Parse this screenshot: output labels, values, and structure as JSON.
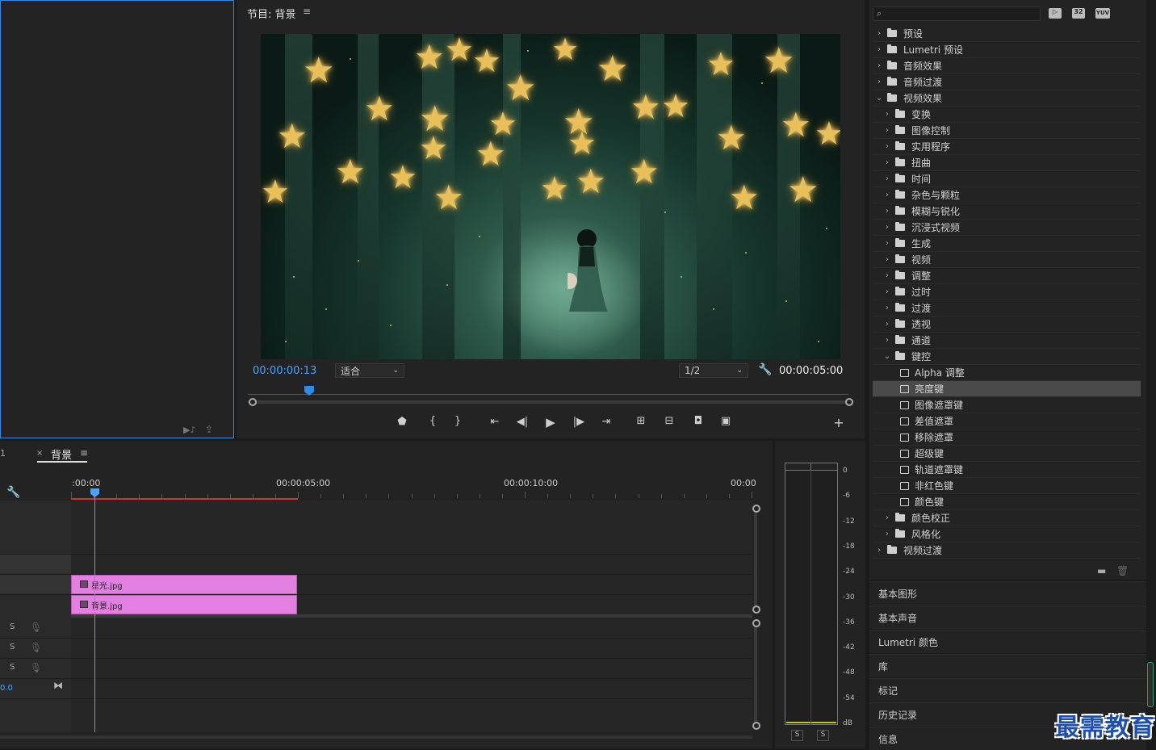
{
  "program": {
    "title": "节目: 背景",
    "menu_icon": "hamburger-icon",
    "timecode": "00:00:00:13",
    "fit_value": "适合",
    "resolution_value": "1/2",
    "duration": "00:00:05:00"
  },
  "effects": {
    "search_placeholder": "",
    "badges": [
      "32",
      "YUV"
    ],
    "items": [
      {
        "label": "预设",
        "level": 0,
        "expanded": false,
        "type": "folder"
      },
      {
        "label": "Lumetri 预设",
        "level": 0,
        "expanded": false,
        "type": "folder"
      },
      {
        "label": "音频效果",
        "level": 0,
        "expanded": false,
        "type": "folder"
      },
      {
        "label": "音频过渡",
        "level": 0,
        "expanded": false,
        "type": "folder"
      },
      {
        "label": "视频效果",
        "level": 0,
        "expanded": true,
        "type": "folder"
      },
      {
        "label": "变换",
        "level": 1,
        "expanded": false,
        "type": "folder"
      },
      {
        "label": "图像控制",
        "level": 1,
        "expanded": false,
        "type": "folder"
      },
      {
        "label": "实用程序",
        "level": 1,
        "expanded": false,
        "type": "folder"
      },
      {
        "label": "扭曲",
        "level": 1,
        "expanded": false,
        "type": "folder"
      },
      {
        "label": "时间",
        "level": 1,
        "expanded": false,
        "type": "folder"
      },
      {
        "label": "杂色与颗粒",
        "level": 1,
        "expanded": false,
        "type": "folder"
      },
      {
        "label": "模糊与锐化",
        "level": 1,
        "expanded": false,
        "type": "folder"
      },
      {
        "label": "沉浸式视频",
        "level": 1,
        "expanded": false,
        "type": "folder"
      },
      {
        "label": "生成",
        "level": 1,
        "expanded": false,
        "type": "folder"
      },
      {
        "label": "视频",
        "level": 1,
        "expanded": false,
        "type": "folder"
      },
      {
        "label": "调整",
        "level": 1,
        "expanded": false,
        "type": "folder"
      },
      {
        "label": "过时",
        "level": 1,
        "expanded": false,
        "type": "folder"
      },
      {
        "label": "过渡",
        "level": 1,
        "expanded": false,
        "type": "folder"
      },
      {
        "label": "透视",
        "level": 1,
        "expanded": false,
        "type": "folder"
      },
      {
        "label": "通道",
        "level": 1,
        "expanded": false,
        "type": "folder"
      },
      {
        "label": "键控",
        "level": 1,
        "expanded": true,
        "type": "folder"
      },
      {
        "label": "Alpha 调整",
        "level": 2,
        "type": "effect"
      },
      {
        "label": "亮度键",
        "level": 2,
        "type": "effect",
        "selected": true
      },
      {
        "label": "图像遮罩键",
        "level": 2,
        "type": "effect"
      },
      {
        "label": "差值遮罩",
        "level": 2,
        "type": "effect"
      },
      {
        "label": "移除遮罩",
        "level": 2,
        "type": "effect"
      },
      {
        "label": "超级键",
        "level": 2,
        "type": "effect"
      },
      {
        "label": "轨道遮罩键",
        "level": 2,
        "type": "effect"
      },
      {
        "label": "非红色键",
        "level": 2,
        "type": "effect"
      },
      {
        "label": "颜色键",
        "level": 2,
        "type": "effect"
      },
      {
        "label": "颜色校正",
        "level": 1,
        "expanded": false,
        "type": "folder"
      },
      {
        "label": "风格化",
        "level": 1,
        "expanded": false,
        "type": "folder"
      },
      {
        "label": "视频过渡",
        "level": 0,
        "expanded": false,
        "type": "folder"
      }
    ]
  },
  "side_panels": [
    "基本图形",
    "基本声音",
    "Lumetri 颜色",
    "库",
    "标记",
    "历史记录",
    "信息"
  ],
  "timeline": {
    "tab_number": "1",
    "tab_close": "×",
    "tab_label": "背景",
    "ruler": [
      ":00:00",
      "00:00:05:00",
      "00:00:10:00",
      "00:00"
    ],
    "clips": [
      {
        "name": "星光.jpg"
      },
      {
        "name": "背景.jpg"
      }
    ],
    "audio_track_letters": [
      "S",
      "S",
      "S"
    ],
    "master_value": "0.0"
  },
  "meter": {
    "db_labels": [
      "0",
      "-6",
      "-12",
      "-18",
      "-24",
      "-30",
      "-36",
      "-42",
      "-48",
      "-54",
      "dB"
    ],
    "solo_buttons": [
      "S",
      "S"
    ]
  },
  "watermark": "最需教育"
}
